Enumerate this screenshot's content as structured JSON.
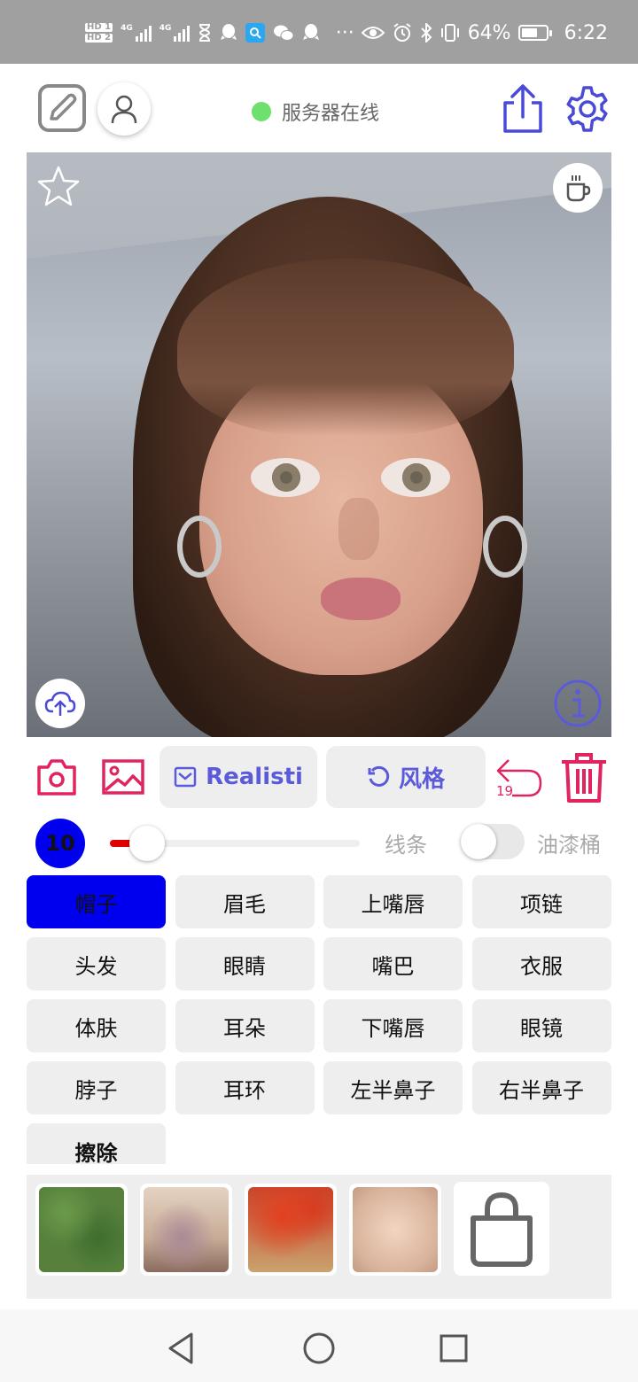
{
  "status_bar": {
    "sim1": "HD 1",
    "sim2": "HD 2",
    "network1": "4G",
    "network2": "4G",
    "battery_percent": "64%",
    "battery_level": 0.64,
    "time": "6:22",
    "overflow": "···"
  },
  "header": {
    "server_status": "服务器在线",
    "server_status_color": "#6ee06e"
  },
  "canvas": {
    "description_icons": [
      "star-icon",
      "coffee-icon",
      "cloud-upload-icon",
      "info-icon"
    ]
  },
  "toolbar": {
    "realistic_label": "Realisti",
    "style_label": "风格",
    "undo_count": "19",
    "accent": "#5a5adb",
    "danger": "#e0245e"
  },
  "brush": {
    "size": "10",
    "slider_value": 0.15,
    "line_label": "线条",
    "fill_label": "油漆桶",
    "fill_enabled": false
  },
  "parts": [
    {
      "label": "帽子",
      "active": true
    },
    {
      "label": "眉毛",
      "active": false
    },
    {
      "label": "上嘴唇",
      "active": false
    },
    {
      "label": "项链",
      "active": false
    },
    {
      "label": "头发",
      "active": false
    },
    {
      "label": "眼睛",
      "active": false
    },
    {
      "label": "嘴巴",
      "active": false
    },
    {
      "label": "衣服",
      "active": false
    },
    {
      "label": "体肤",
      "active": false
    },
    {
      "label": "耳朵",
      "active": false
    },
    {
      "label": "下嘴唇",
      "active": false
    },
    {
      "label": "眼镜",
      "active": false
    },
    {
      "label": "脖子",
      "active": false
    },
    {
      "label": "耳环",
      "active": false
    },
    {
      "label": "左半鼻子",
      "active": false
    },
    {
      "label": "右半鼻子",
      "active": false
    },
    {
      "label": "擦除",
      "active": false
    }
  ],
  "textures": [
    {
      "name": "green-foliage"
    },
    {
      "name": "lace-fabric"
    },
    {
      "name": "red-flowers"
    },
    {
      "name": "skin-blur"
    }
  ]
}
